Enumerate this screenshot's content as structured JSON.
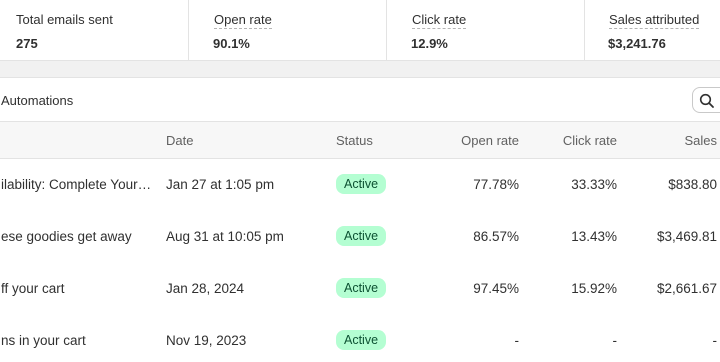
{
  "metrics": [
    {
      "label": "Total emails sent",
      "value": "275"
    },
    {
      "label": "Open rate",
      "value": "90.1%"
    },
    {
      "label": "Click rate",
      "value": "12.9%"
    },
    {
      "label": "Sales attributed",
      "value": "$3,241.76"
    }
  ],
  "tab": {
    "label": "Automations"
  },
  "search": {
    "icon": "search-icon"
  },
  "columns": {
    "name": "",
    "date": "Date",
    "status": "Status",
    "open_rate": "Open rate",
    "click_rate": "Click rate",
    "sales": "Sales"
  },
  "rows": [
    {
      "name": "ilability: Complete Your…",
      "date": "Jan 27 at 1:05 pm",
      "status": "Active",
      "open_rate": "77.78%",
      "click_rate": "33.33%",
      "sales": "$838.80"
    },
    {
      "name": "ese goodies get away",
      "date": "Aug 31 at 10:05 pm",
      "status": "Active",
      "open_rate": "86.57%",
      "click_rate": "13.43%",
      "sales": "$3,469.81"
    },
    {
      "name": "ff your cart",
      "date": "Jan 28, 2024",
      "status": "Active",
      "open_rate": "97.45%",
      "click_rate": "15.92%",
      "sales": "$2,661.67"
    },
    {
      "name": "ns in your cart",
      "date": "Nov 19, 2023",
      "status": "Active",
      "open_rate": "-",
      "click_rate": "-",
      "sales": "-"
    }
  ],
  "colors": {
    "badge_bg": "#b4fed2",
    "badge_text": "#0c5132"
  }
}
